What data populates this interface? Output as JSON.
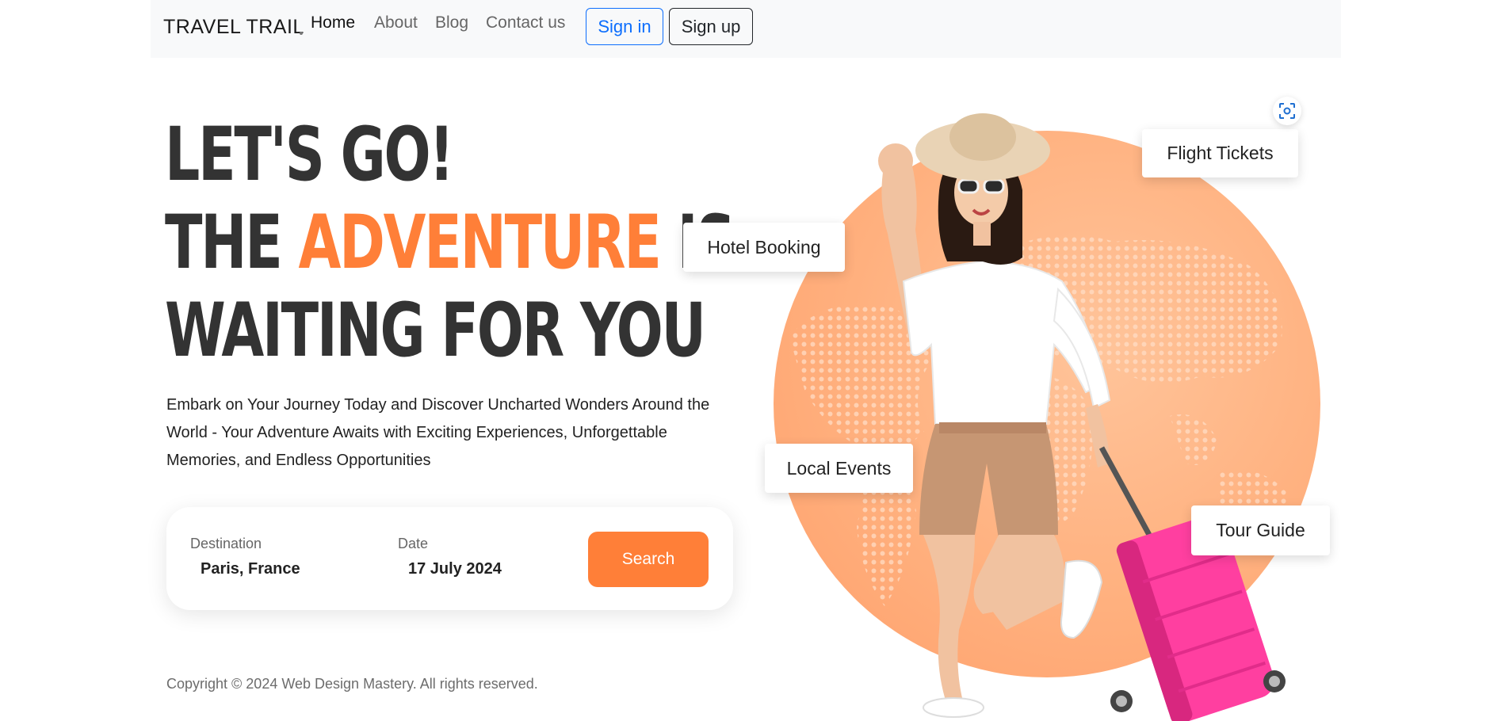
{
  "nav": {
    "brand": "TRAVEL TRAIL",
    "links": [
      {
        "label": "Home",
        "active": true
      },
      {
        "label": "About",
        "active": false
      },
      {
        "label": "Blog",
        "active": false
      },
      {
        "label": "Contact us",
        "active": false
      }
    ],
    "signin_label": "Sign in",
    "signup_label": "Sign up"
  },
  "hero": {
    "line1": "LET'S GO!",
    "line2_pre": "THE ",
    "line2_accent": "ADVENTURE",
    "line2_post": " IS",
    "line3": "WAITING FOR YOU",
    "subtext": "Embark on Your Journey Today and Discover Uncharted Wonders Around the World - Your Adventure Awaits with Exciting Experiences, Unforgettable Memories, and Endless Opportunities"
  },
  "search": {
    "destination_label": "Destination",
    "destination_value": "Paris, France",
    "date_label": "Date",
    "date_value": "17 July 2024",
    "button_label": "Search"
  },
  "tags": {
    "flight": "Flight Tickets",
    "hotel": "Hotel Booking",
    "events": "Local Events",
    "guide": "Tour Guide"
  },
  "footer": {
    "copyright": "Copyright © 2024 Web Design Mastery. All rights reserved."
  },
  "colors": {
    "accent": "#ff7f38",
    "primary": "#0d6efd",
    "heading": "#333333",
    "globe": "#ffb07e",
    "suitcase": "#ff3fa0"
  },
  "icons": {
    "scan": "focus-scan-icon"
  }
}
